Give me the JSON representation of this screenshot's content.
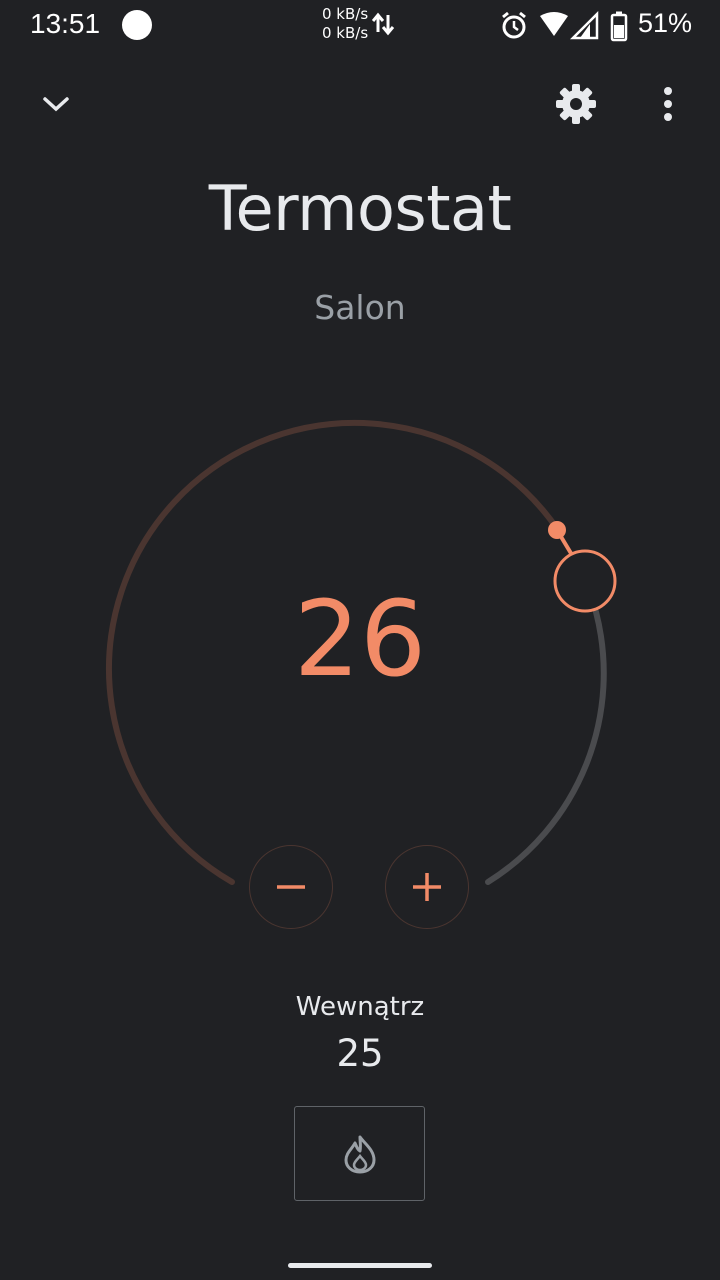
{
  "status_bar": {
    "time": "13:51",
    "speed_up": "0 kB/s",
    "speed_down": "0 kB/s",
    "battery_percent": "51%",
    "icons": [
      "record-dot-icon",
      "data-arrows-icon",
      "alarm-icon",
      "wifi-icon",
      "cellular-icon",
      "battery-icon"
    ]
  },
  "app_bar": {
    "icons": [
      "chevron-down-icon",
      "gear-icon",
      "more-vert-icon"
    ]
  },
  "thermostat": {
    "title": "Termostat",
    "room": "Salon",
    "target_temperature": "26",
    "minus_label": "−",
    "plus_label": "+",
    "inside_label": "Wewnątrz",
    "inside_temperature": "25",
    "mode_icon": "flame-icon",
    "dial_level": 0.72
  },
  "colors": {
    "background": "#202124",
    "accent": "#f28b67",
    "track_active": "#4a3530",
    "track_inactive": "#4a4b4e",
    "text_secondary": "#9aa0a6"
  }
}
